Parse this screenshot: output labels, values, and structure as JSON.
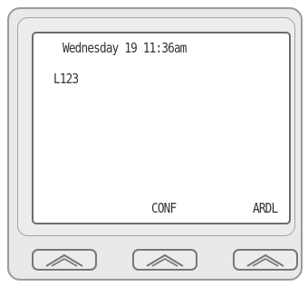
{
  "display": {
    "status_line": "Wednesday 19 11:36am",
    "line_id": "L123"
  },
  "softkeys": [
    {
      "label": "",
      "icon": "chevron-up-icon"
    },
    {
      "label": "CONF",
      "icon": "chevron-up-icon"
    },
    {
      "label": "ARDL",
      "icon": "chevron-up-icon"
    }
  ],
  "colors": {
    "bezel": "#e9e9e9",
    "screen": "#ffffff",
    "text": "#333333",
    "outline": "#777777"
  }
}
